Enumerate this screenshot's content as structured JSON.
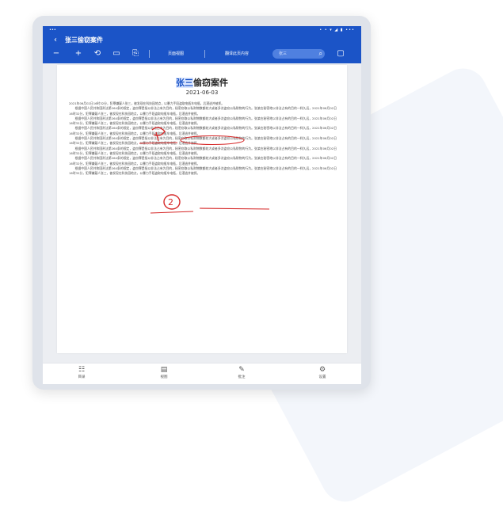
{
  "statusbar": {
    "time": "•••",
    "system": "• • ▾ ◢ ▮ •••"
  },
  "header": {
    "back_icon": "‹",
    "title": "张三偷窃案件"
  },
  "toolbar": {
    "minus_icon": "−",
    "plus_icon": "+",
    "rotate_icon": "⟲",
    "fit_icon": "▭",
    "copy_icon": "⎘",
    "page_mode_label": "页面视图",
    "sign_label": "翻译此页内容",
    "search_placeholder": "张三",
    "search_icon": "⌕",
    "more_icon": "▢"
  },
  "document": {
    "title_highlight": "张三",
    "title_rest": "偷窃案件",
    "date": "2021-06-03",
    "intro": "2021年06月02日16时32分，犯罪嫌疑人张三，被发现在科技园地点，以暴力手段盗取电瓶车电瓶，后潜逃并被抓。",
    "paragraphs": [
      "根据中国人民共和国刑法第264条的规定，盗窃罪是指以非法占有为目的，秘密窃取公私财物数额较大或者多次盗窃公私财物的行为。张某在秘密地以非法占有的目的一样久远，2021年06月02日16时32分，犯罪嫌疑人张三，被发现在科技园地点，以暴力手段盗取电瓶车电瓶，后潜逃并被抓。",
      "根据中国人民共和国刑法第264条的规定，盗窃罪是指以非法占有为目的，秘密窃取公私财物数额较大或者多次盗窃公私财物的行为。张某在秘密地以非法占有的目的一样久远，2021年06月02日16时32分，犯罪嫌疑人张三，被发现在科技园地点，以暴力手段盗取电瓶车电瓶，后潜逃并被抓。",
      "根据中国人民共和国刑法第264条的规定，盗窃罪是指以非法占有为目的，秘密窃取公私财物数额较大或者多次盗窃公私财物的行为。张某在秘密地以非法占有的目的一样久远，2021年06月02日16时32分，犯罪嫌疑人张三，被发现在科技园地点，以暴力手段盗取电瓶车电瓶，后潜逃并被抓。",
      "根据中国人民共和国刑法第264条的规定，盗窃罪是指以非法占有为目的，秘密窃取公私财物数额较大或者多次盗窃公私财物的行为。张某在秘密地以非法占有的目的一样久远，2021年06月02日16时32分，犯罪嫌疑人张三，被发现在科技园地点，以暴力手段盗取电瓶车电瓶，后潜逃并被抓。",
      "根据中国人民共和国刑法第264条的规定，盗窃罪是指以非法占有为目的，秘密窃取公私财物数额较大或者多次盗窃公私财物的行为。张某在秘密地以非法占有的目的一样久远，2021年06月02日16时32分，犯罪嫌疑人张三，被发现在科技园地点，以暴力手段盗取电瓶车电瓶，后潜逃并被抓。",
      "根据中国人民共和国刑法第264条的规定，盗窃罪是指以非法占有为目的，秘密窃取公私财物数额较大或者多次盗窃公私财物的行为。张某在秘密地以非法占有的目的一样久远，2021年06月02日16时32分，犯罪嫌疑人张三，被发现在科技园地点，以暴力手段盗取电瓶车电瓶，后潜逃并被抓。",
      "根据中国人民共和国刑法第264条的规定，盗窃罪是指以非法占有为目的，秘密窃取公私财物数额较大或者多次盗窃公私财物的行为。张某在秘密地以非法占有的目的一样久远，2021年06月02日16时32分，犯罪嫌疑人张三，被发现在科技园地点，以暴力手段盗取电瓶车电瓶，后潜逃并被抓。"
    ],
    "annotation_1": "1",
    "annotation_2": "2"
  },
  "bottom_nav": [
    {
      "icon": "☷",
      "label": "目录"
    },
    {
      "icon": "▤",
      "label": "视图"
    },
    {
      "icon": "✎",
      "label": "批注"
    },
    {
      "icon": "⚙",
      "label": "设置"
    }
  ],
  "colors": {
    "primary": "#1b54c7",
    "annotation": "#d62828"
  }
}
